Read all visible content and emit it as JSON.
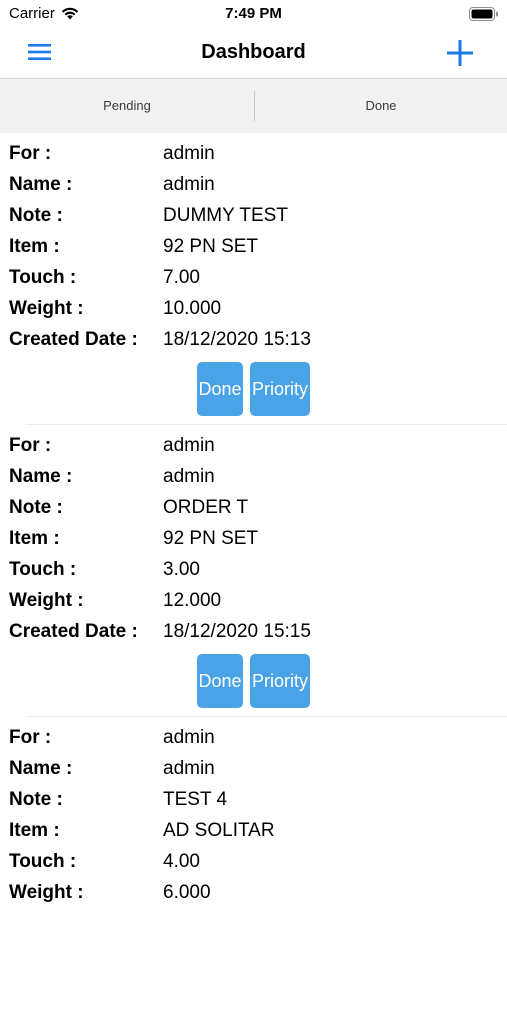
{
  "status_bar": {
    "carrier": "Carrier",
    "time": "7:49 PM"
  },
  "nav": {
    "title": "Dashboard",
    "menu_icon": "hamburger-menu-icon",
    "add_icon": "plus-icon",
    "accent": "#1a7ae8"
  },
  "segments": {
    "pending": "Pending",
    "done": "Done"
  },
  "labels": {
    "for": "For :",
    "name": "Name :",
    "note": "Note :",
    "item": "Item :",
    "touch": "Touch :",
    "weight": "Weight :",
    "created": "Created Date :"
  },
  "buttons": {
    "done": "Done",
    "priority": "Priority",
    "color": "#4aa3e6"
  },
  "orders": [
    {
      "for": "admin",
      "name": "admin",
      "note": "DUMMY TEST",
      "item": "92 PN SET",
      "touch": "7.00",
      "weight": "10.000",
      "created": "18/12/2020 15:13"
    },
    {
      "for": "admin",
      "name": "admin",
      "note": "ORDER T",
      "item": "92 PN SET",
      "touch": "3.00",
      "weight": "12.000",
      "created": "18/12/2020 15:15"
    },
    {
      "for": "admin",
      "name": "admin",
      "note": "TEST 4",
      "item": "AD SOLITAR",
      "touch": "4.00",
      "weight": "6.000"
    }
  ]
}
